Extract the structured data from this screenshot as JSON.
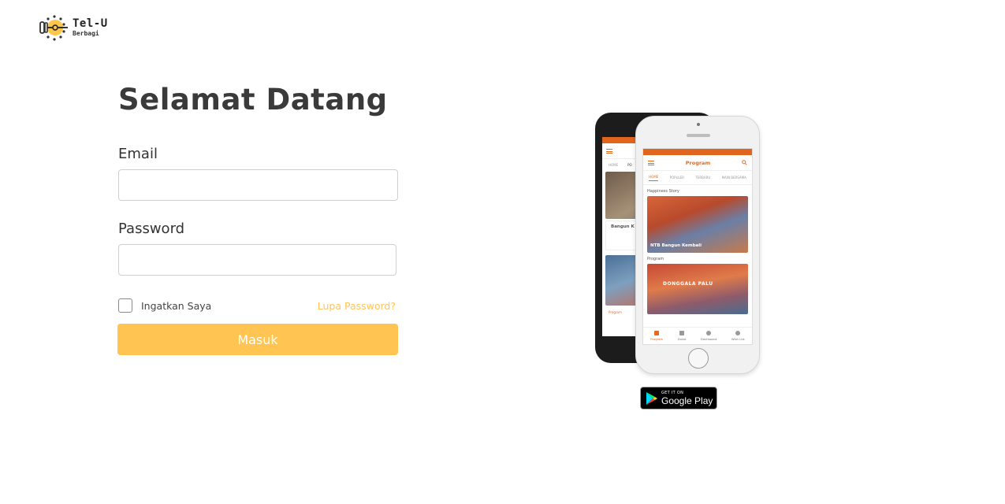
{
  "logo": {
    "title": "Tel-U",
    "subtitle": "Berbagi",
    "icon": "key-sun-icon"
  },
  "form": {
    "heading": "Selamat Datang",
    "email_label": "Email",
    "email_value": "",
    "password_label": "Password",
    "password_value": "",
    "remember_label": "Ingatkan Saya",
    "remember_checked": false,
    "forgot_label": "Lupa Password?",
    "submit_label": "Masuk"
  },
  "promo": {
    "front_app": {
      "title": "Program",
      "tabs": [
        "HOME",
        "POPULER",
        "TERBARU",
        "MAIN BERSAMA"
      ],
      "section1": "Happiness Story",
      "card1_caption": "NTB Bangun Kembali",
      "section2": "Program",
      "card2_caption": "DONGGALA PALU",
      "nav": [
        "Program",
        "Zakat",
        "Dashboard",
        "Wish List"
      ]
    },
    "back_app": {
      "tabs": [
        "HOME",
        "PO"
      ],
      "card_title": "Bangun K",
      "card_count": "1",
      "card_sub": "Hari Lagi",
      "nav": [
        "Program"
      ]
    },
    "store_badge": {
      "small_text": "GET IT ON",
      "big_text": "Google Play",
      "icon": "google-play-icon"
    }
  },
  "colors": {
    "accent": "#ffc451",
    "link": "#ffc45a",
    "app_orange": "#e36a1d"
  }
}
